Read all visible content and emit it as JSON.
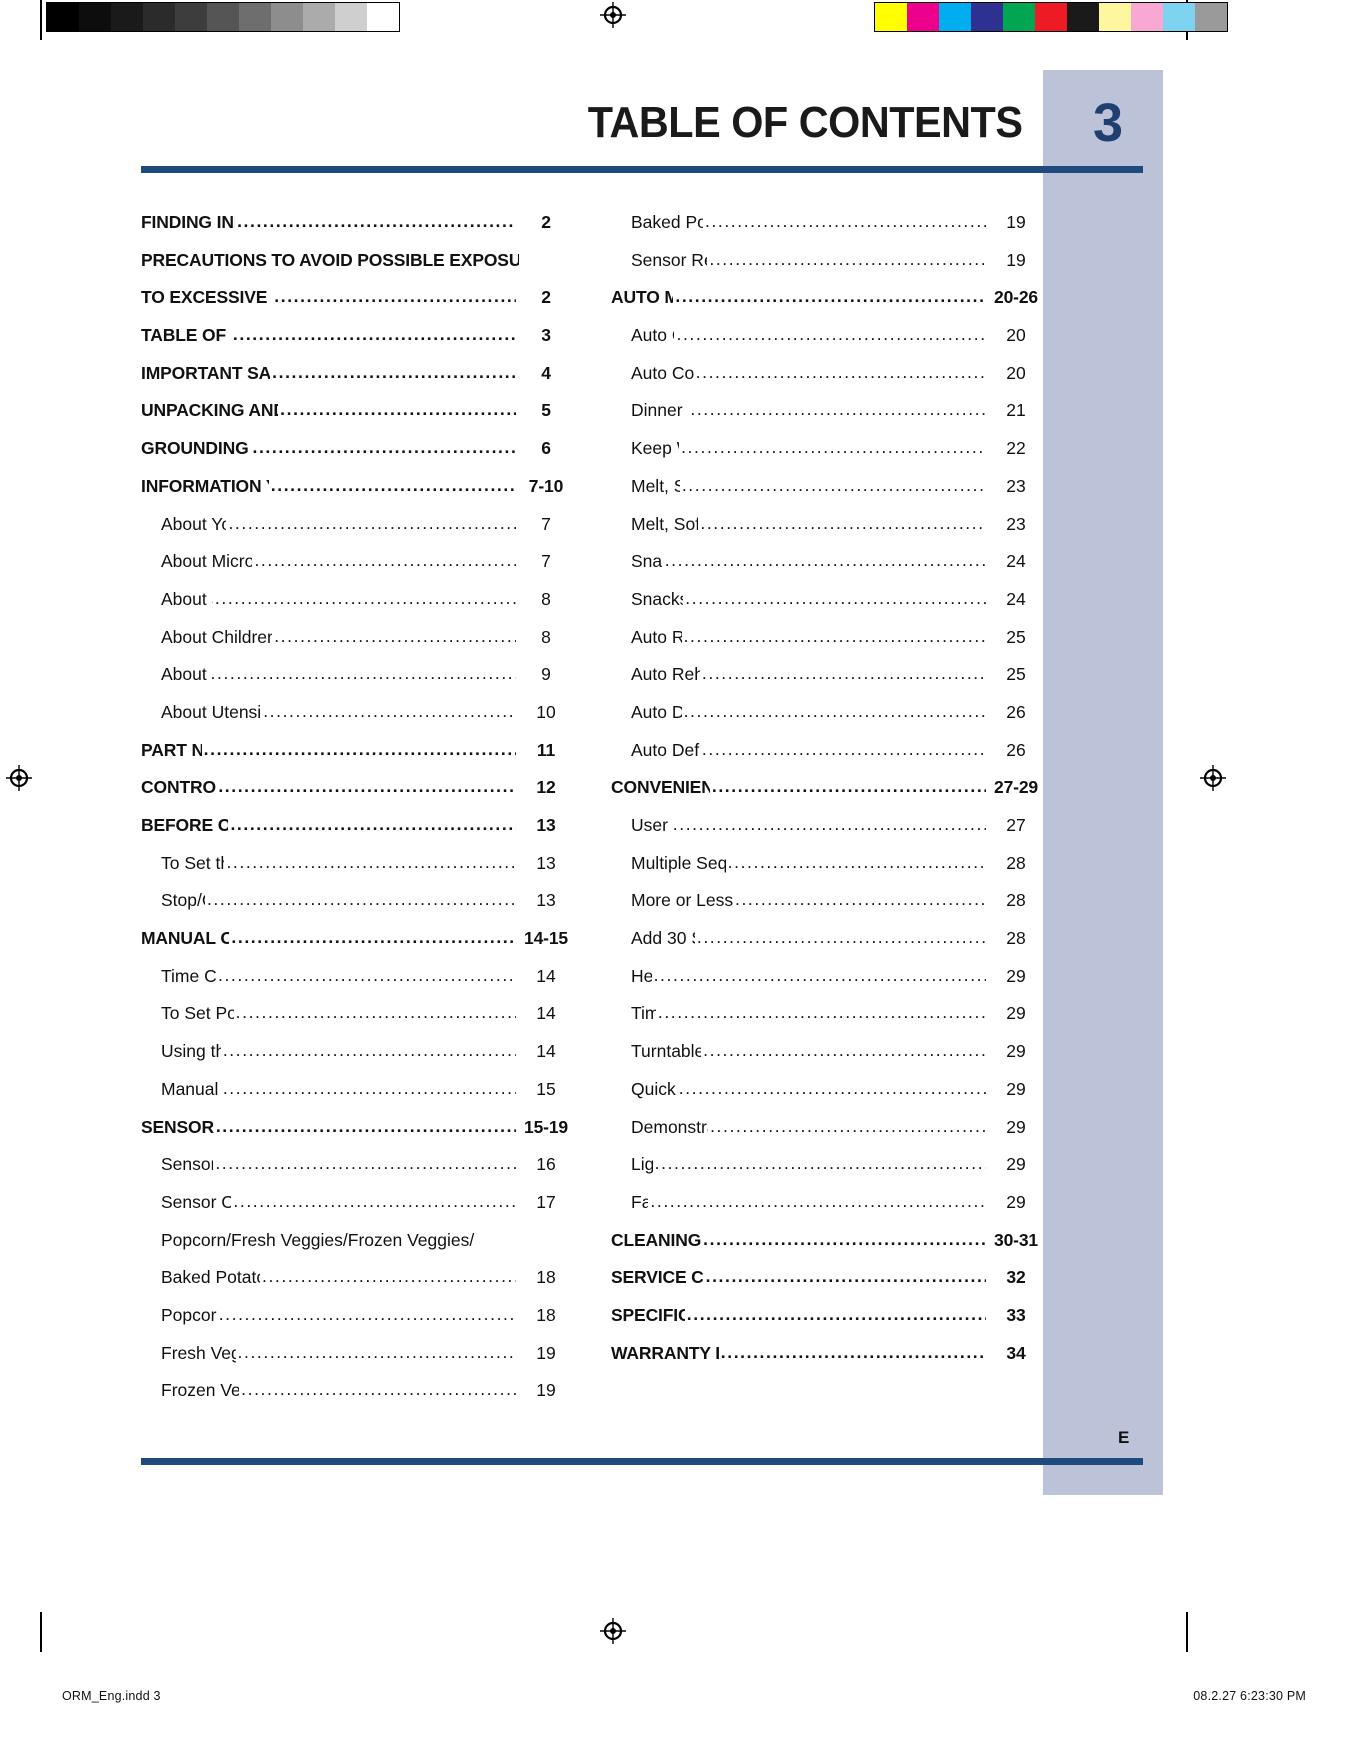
{
  "header": {
    "title": "TABLE OF CONTENTS",
    "page_number": "3",
    "sidebar_letter": "E"
  },
  "calibration": {
    "greyscale_swatches": [
      "#000000",
      "#0d0d0d",
      "#1a1a1a",
      "#2b2b2b",
      "#3d3d3d",
      "#555555",
      "#6e6e6e",
      "#8d8d8d",
      "#ababab",
      "#cfcfcf",
      "#ffffff"
    ],
    "color_swatches": [
      "#ffff00",
      "#ec008c",
      "#00aeef",
      "#2e3192",
      "#00a651",
      "#ed1c24",
      "#1a1a1a",
      "#fff6a0",
      "#f9a8d4",
      "#7dd3f0",
      "#9a9a9a"
    ]
  },
  "toc": {
    "left_column": [
      {
        "label": "FINDING INFORMATION",
        "page": "2",
        "level": 1,
        "continuation": false
      },
      {
        "label": "PRECAUTIONS TO AVOID POSSIBLE EXPOSURE",
        "page": "",
        "level": 1,
        "continuation": true
      },
      {
        "label": "TO EXCESSIVE MICROWAVE ENERGY",
        "page": "2",
        "level": 1,
        "continuation": false
      },
      {
        "label": "TABLE OF CONTENTS",
        "page": "3",
        "level": 1,
        "continuation": false
      },
      {
        "label": "IMPORTANT SAFETY INSTRUCTIONS",
        "page": "4",
        "level": 1,
        "continuation": false
      },
      {
        "label": "UNPACKING AND EXAMING YOUR OVEN",
        "page": "5",
        "level": 1,
        "continuation": false
      },
      {
        "label": "GROUNDING INSTRUCTIONS",
        "page": "6",
        "level": 1,
        "continuation": false
      },
      {
        "label": "INFORMATION YOU NEED TO KNOW",
        "page": "7-10",
        "level": 1,
        "continuation": false
      },
      {
        "label": "About Your Oven",
        "page": "7",
        "level": 2,
        "continuation": false
      },
      {
        "label": "About Microwave Cooking",
        "page": "7",
        "level": 2,
        "continuation": false
      },
      {
        "label": "About Safety",
        "page": "8",
        "level": 2,
        "continuation": false
      },
      {
        "label": "About Children and the Microwave",
        "page": "8",
        "level": 2,
        "continuation": false
      },
      {
        "label": "About Food",
        "page": "9",
        "level": 2,
        "continuation": false
      },
      {
        "label": "About Utensils and Coverings",
        "page": "10",
        "level": 2,
        "continuation": false
      },
      {
        "label": "PART NAMES",
        "page": "11",
        "level": 1,
        "continuation": false
      },
      {
        "label": "CONTROL PANEL",
        "page": "12",
        "level": 1,
        "continuation": false
      },
      {
        "label": "BEFORE OPERATING",
        "page": "13",
        "level": 1,
        "continuation": false
      },
      {
        "label": "To Set the Clock",
        "page": "13",
        "level": 2,
        "continuation": false
      },
      {
        "label": "Stop/Clear",
        "page": "13",
        "level": 2,
        "continuation": false
      },
      {
        "label": "MANUAL OPERATION",
        "page": "14-15",
        "level": 1,
        "continuation": false
      },
      {
        "label": "Time Cooking",
        "page": "14",
        "level": 2,
        "continuation": false
      },
      {
        "label": "To Set Power Level",
        "page": "14",
        "level": 2,
        "continuation": false
      },
      {
        "label": "Using the Rack",
        "page": "14",
        "level": 2,
        "continuation": false
      },
      {
        "label": "Manual Defrost",
        "page": "15",
        "level": 2,
        "continuation": false
      },
      {
        "label": "SENSOR MODES",
        "page": "15-19",
        "level": 1,
        "continuation": false
      },
      {
        "label": "Sensor Cook",
        "page": "16",
        "level": 2,
        "continuation": false
      },
      {
        "label": "Sensor Cook chart",
        "page": "17",
        "level": 2,
        "continuation": false
      },
      {
        "label": "Popcorn/Fresh Veggies/Frozen Veggies/",
        "page": "",
        "level": 2,
        "continuation": true
      },
      {
        "label": "Baked Potato/Sensor Reheat",
        "page": "18",
        "level": 2,
        "continuation": false
      },
      {
        "label": "Popcorn chart",
        "page": "18",
        "level": 2,
        "continuation": false
      },
      {
        "label": "Fresh Veggies chart",
        "page": "19",
        "level": 2,
        "continuation": false
      },
      {
        "label": "Frozen Veggies chart",
        "page": "19",
        "level": 2,
        "continuation": false
      }
    ],
    "right_column": [
      {
        "label": "Baked Potato chart",
        "page": "19",
        "level": 2,
        "continuation": false
      },
      {
        "label": "Sensor Reheat chart",
        "page": "19",
        "level": 2,
        "continuation": false
      },
      {
        "label": "AUTO MODES",
        "page": "20-26",
        "level": 1,
        "continuation": false
      },
      {
        "label": "Auto Cook",
        "page": "20",
        "level": 2,
        "continuation": false
      },
      {
        "label": "Auto Cook chart",
        "page": "20",
        "level": 2,
        "continuation": false
      },
      {
        "label": "Dinner recipes",
        "page": "21",
        "level": 2,
        "continuation": false
      },
      {
        "label": "Keep Warm",
        "page": "22",
        "level": 2,
        "continuation": false
      },
      {
        "label": "Melt, Soften",
        "page": "23",
        "level": 2,
        "continuation": false
      },
      {
        "label": "Melt, Soften chart",
        "page": "23",
        "level": 2,
        "continuation": false
      },
      {
        "label": "Snacks",
        "page": "24",
        "level": 2,
        "continuation": false
      },
      {
        "label": "Snacks chart",
        "page": "24",
        "level": 2,
        "continuation": false
      },
      {
        "label": "Auto Reheat",
        "page": "25",
        "level": 2,
        "continuation": false
      },
      {
        "label": "Auto Reheat chart",
        "page": "25",
        "level": 2,
        "continuation": false
      },
      {
        "label": "Auto Defrost",
        "page": "26",
        "level": 2,
        "continuation": false
      },
      {
        "label": "Auto Defrost chart",
        "page": "26",
        "level": 2,
        "continuation": false
      },
      {
        "label": "CONVENIENT FEATURES",
        "page": "27-29",
        "level": 1,
        "continuation": false
      },
      {
        "label": "User Pref",
        "page": "27",
        "level": 2,
        "continuation": false
      },
      {
        "label": "Multiple Sequence Cooking",
        "page": "28",
        "level": 2,
        "continuation": false
      },
      {
        "label": "More or Less Time Adjustment",
        "page": "28",
        "level": 2,
        "continuation": false
      },
      {
        "label": "Add 30 Seconds",
        "page": "28",
        "level": 2,
        "continuation": false
      },
      {
        "label": "Help",
        "page": "29",
        "level": 2,
        "continuation": false
      },
      {
        "label": "Timer",
        "page": "29",
        "level": 2,
        "continuation": false
      },
      {
        "label": "Turntable ON/OFF",
        "page": "29",
        "level": 2,
        "continuation": false
      },
      {
        "label": "Quick Start",
        "page": "29",
        "level": 2,
        "continuation": false
      },
      {
        "label": "Demonstration Mode",
        "page": "29",
        "level": 2,
        "continuation": false
      },
      {
        "label": "Light",
        "page": "29",
        "level": 2,
        "continuation": false
      },
      {
        "label": "Fan",
        "page": "29",
        "level": 2,
        "continuation": false
      },
      {
        "label": "CLEANING AND CARE",
        "page": "30-31",
        "level": 1,
        "continuation": false
      },
      {
        "label": "SERVICE CALL CHECK",
        "page": "32",
        "level": 1,
        "continuation": false
      },
      {
        "label": "SPECIFICATIONS",
        "page": "33",
        "level": 1,
        "continuation": false
      },
      {
        "label": "WARRANTY INFORMATIONS",
        "page": "34",
        "level": 1,
        "continuation": false
      }
    ]
  },
  "footer": {
    "file_info": "ORM_Eng.indd   3",
    "timestamp": "08.2.27   6:23:30 PM"
  },
  "colors": {
    "rule": "#1f4a7d",
    "page_number": "#1f3f6e",
    "sidebar": "#bcc3d8"
  }
}
